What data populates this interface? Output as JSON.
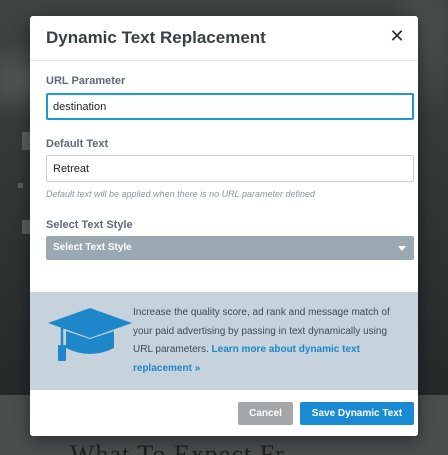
{
  "background": {
    "heading_fragment": "What To Expect Fr..."
  },
  "modal": {
    "title": "Dynamic Text Replacement",
    "close_icon": "close-icon",
    "url_parameter": {
      "label": "URL Parameter",
      "value": "destination"
    },
    "default_text": {
      "label": "Default Text",
      "value": "Retreat",
      "hint": "Default text will be applied when there is no URL parameter defined"
    },
    "text_style": {
      "label": "Select Text Style",
      "selected": "Select Text Style"
    },
    "info": {
      "icon": "graduation-cap-icon",
      "text": "Increase the quality score, ad rank and message match of your paid advertising by passing in text dynamically using URL parameters. ",
      "link": "Learn more about dynamic text replacement »"
    },
    "buttons": {
      "cancel": "Cancel",
      "save": "Save Dynamic Text"
    }
  },
  "colors": {
    "primary": "#1a8ad5",
    "cancel": "#a3a7aa",
    "select": "#9aa8b4",
    "info_panel": "#c6d2dc",
    "focus": "#2196d8"
  }
}
